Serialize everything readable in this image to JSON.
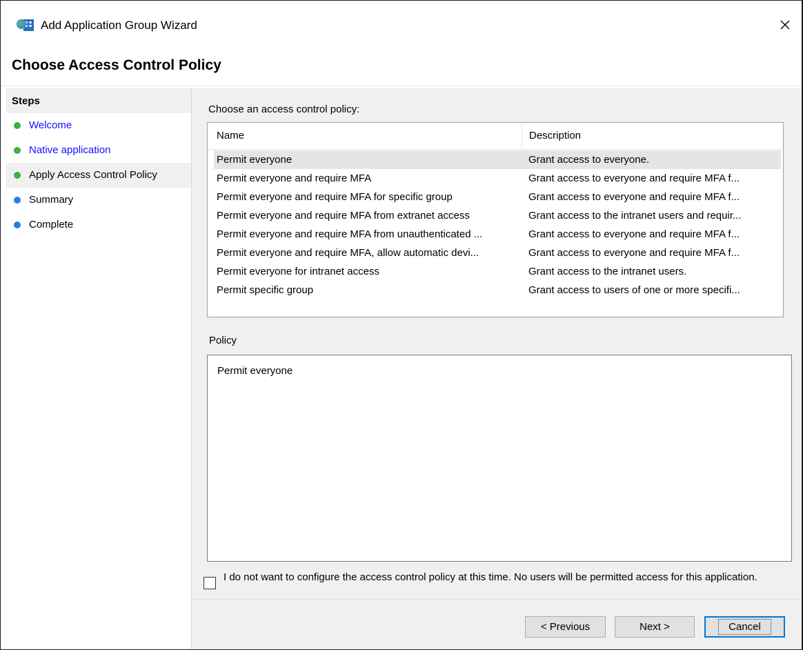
{
  "window": {
    "title": "Add Application Group Wizard"
  },
  "header": {
    "title": "Choose Access Control Policy"
  },
  "steps": {
    "heading": "Steps",
    "items": [
      {
        "label": "Welcome",
        "status": "completed",
        "color": "#3cb043"
      },
      {
        "label": "Native application",
        "status": "completed",
        "color": "#3cb043"
      },
      {
        "label": "Apply Access Control Policy",
        "status": "current",
        "color": "#3cb043"
      },
      {
        "label": "Summary",
        "status": "pending",
        "color": "#2a7de1"
      },
      {
        "label": "Complete",
        "status": "pending",
        "color": "#2a7de1"
      }
    ]
  },
  "policy_list": {
    "label": "Choose an access control policy:",
    "columns": {
      "name": "Name",
      "description": "Description"
    },
    "rows": [
      {
        "name": "Permit everyone",
        "description": "Grant access to everyone.",
        "selected": true
      },
      {
        "name": "Permit everyone and require MFA",
        "description": "Grant access to everyone and require MFA f..."
      },
      {
        "name": "Permit everyone and require MFA for specific group",
        "description": "Grant access to everyone and require MFA f..."
      },
      {
        "name": "Permit everyone and require MFA from extranet access",
        "description": "Grant access to the intranet users and requir..."
      },
      {
        "name": "Permit everyone and require MFA from unauthenticated ...",
        "description": "Grant access to everyone and require MFA f..."
      },
      {
        "name": "Permit everyone and require MFA, allow automatic devi...",
        "description": "Grant access to everyone and require MFA f..."
      },
      {
        "name": "Permit everyone for intranet access",
        "description": "Grant access to the intranet users."
      },
      {
        "name": "Permit specific group",
        "description": "Grant access to users of one or more specifi..."
      }
    ]
  },
  "policy": {
    "label": "Policy",
    "text": "Permit everyone"
  },
  "skip_checkbox": {
    "checked": false,
    "label": "I do not want to configure the access control policy at this time.  No users will be permitted access for this application."
  },
  "buttons": {
    "previous": "< Previous",
    "next": "Next >",
    "cancel": "Cancel"
  },
  "icons": {
    "app": "application-group-icon",
    "close": "close-icon"
  }
}
